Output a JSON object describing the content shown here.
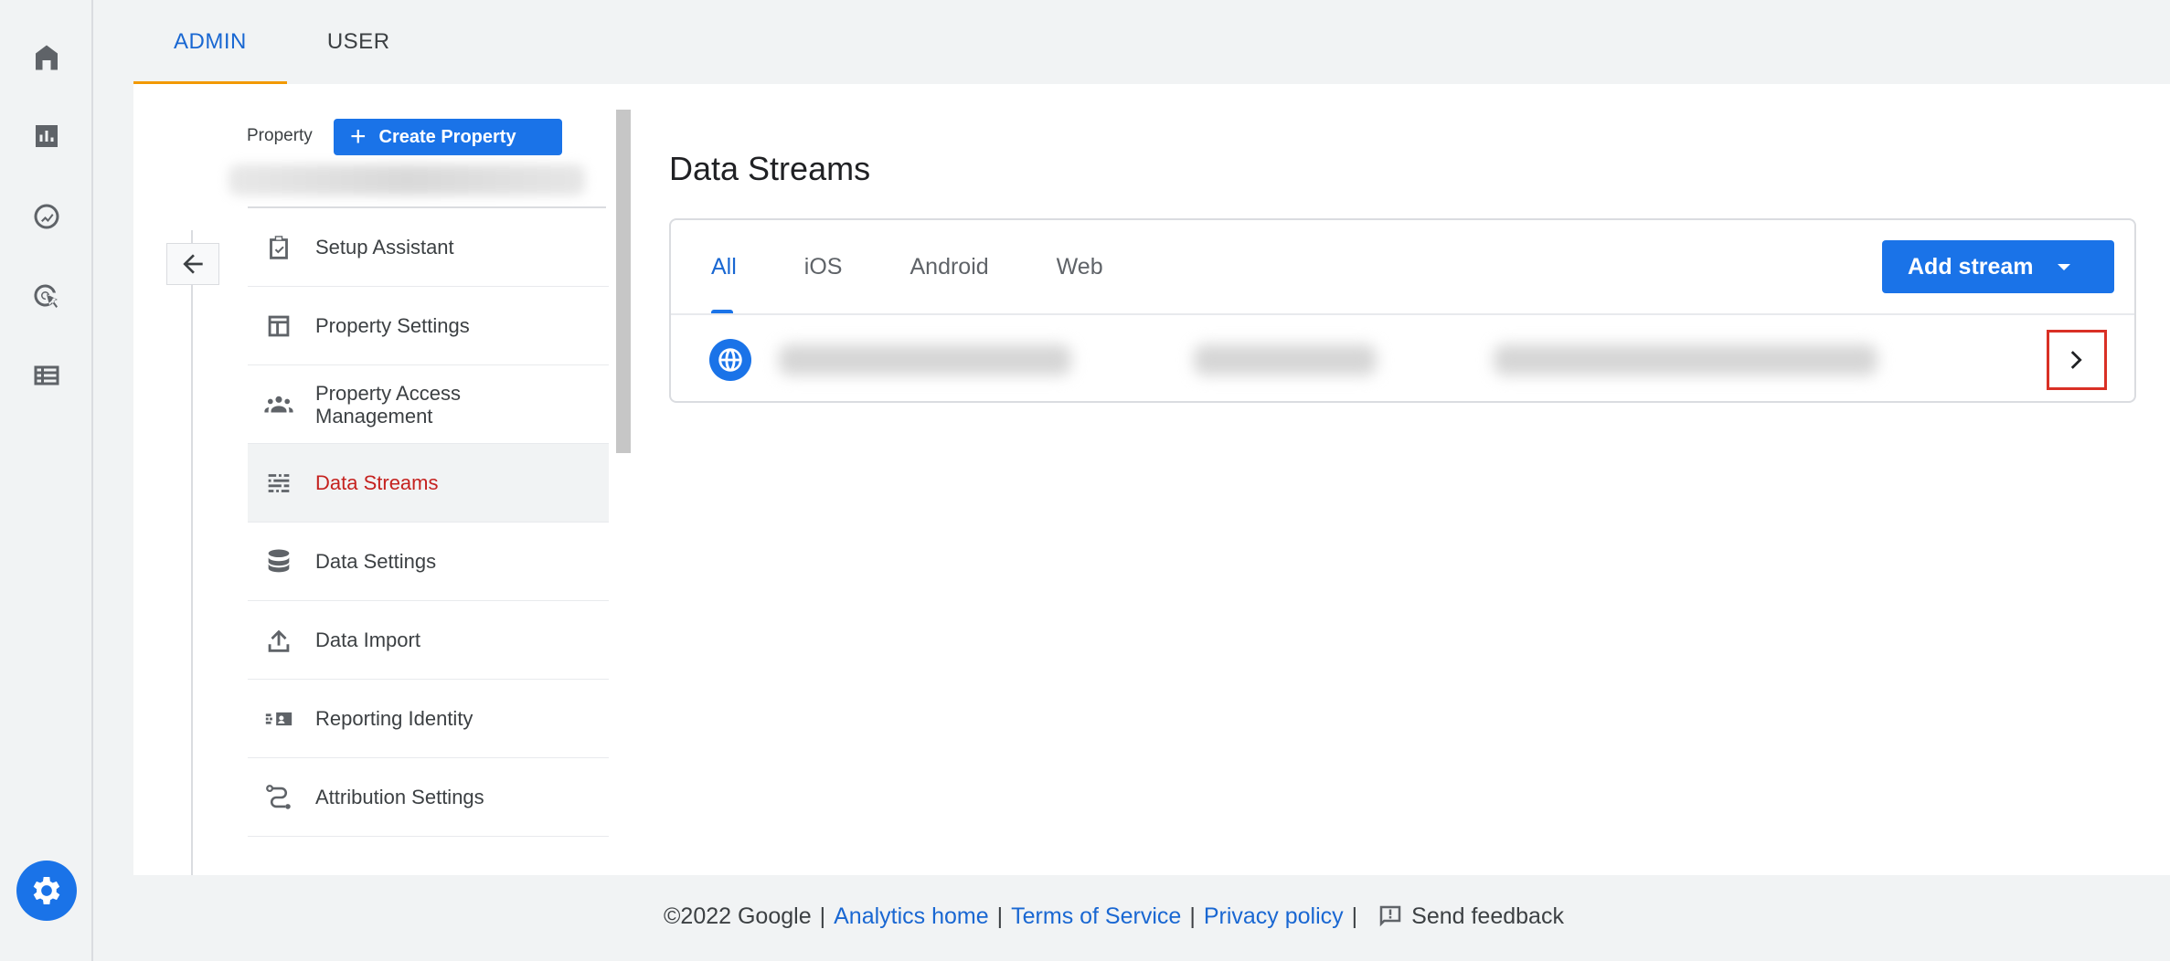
{
  "rail": {
    "icons": [
      "home-icon",
      "bar-chart-icon",
      "explore-icon",
      "advertising-icon",
      "table-icon"
    ],
    "settings_icon": "gear-icon"
  },
  "top_tabs": [
    {
      "label": "ADMIN",
      "active": true
    },
    {
      "label": "USER",
      "active": false
    }
  ],
  "property": {
    "label": "Property",
    "create_label": "Create Property"
  },
  "nav": {
    "items": [
      {
        "label": "Setup Assistant",
        "icon": "clipboard-check-icon"
      },
      {
        "label": "Property Settings",
        "icon": "layout-icon"
      },
      {
        "label": "Property Access Management",
        "icon": "people-icon"
      },
      {
        "label": "Data Streams",
        "icon": "data-streams-icon",
        "active": true
      },
      {
        "label": "Data Settings",
        "icon": "database-icon"
      },
      {
        "label": "Data Import",
        "icon": "upload-icon"
      },
      {
        "label": "Reporting Identity",
        "icon": "reporting-identity-icon"
      },
      {
        "label": "Attribution Settings",
        "icon": "attribution-icon"
      }
    ]
  },
  "content": {
    "title": "Data Streams",
    "tabs": [
      "All",
      "iOS",
      "Android",
      "Web"
    ],
    "active_tab": "All",
    "add_stream_label": "Add stream",
    "stream_icon": "globe-icon"
  },
  "footer": {
    "copyright": "©2022 Google",
    "sep": "|",
    "analytics_home": "Analytics home",
    "terms": "Terms of Service",
    "privacy": "Privacy policy",
    "feedback": "Send feedback"
  },
  "colors": {
    "accent": "#1a73e8",
    "active_nav": "#c5221f",
    "tab_indicator": "#f29900",
    "highlight_box": "#d93025"
  }
}
